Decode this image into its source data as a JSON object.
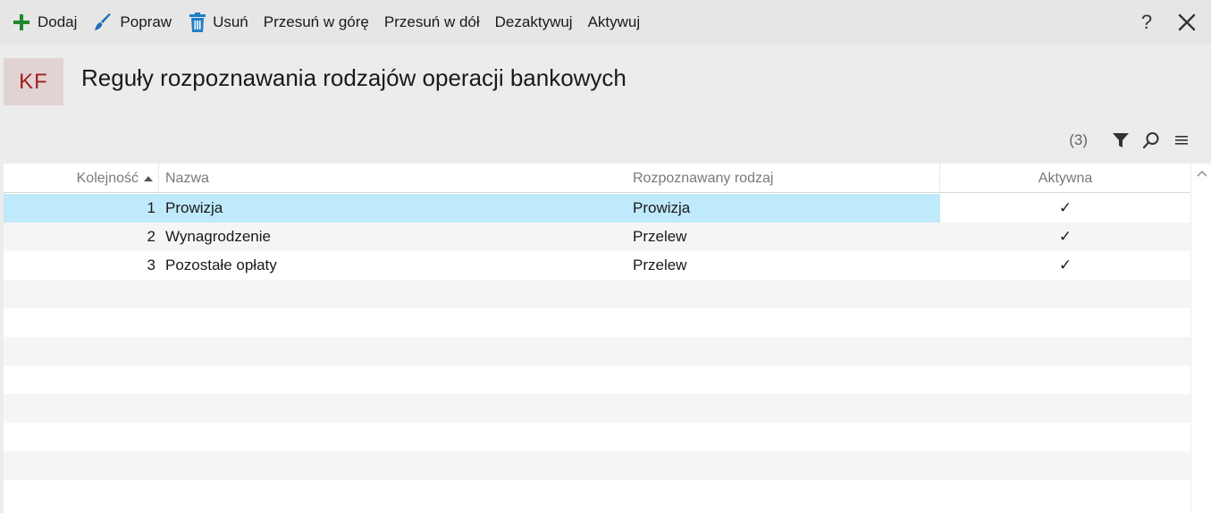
{
  "toolbar": {
    "add_label": "Dodaj",
    "edit_label": "Popraw",
    "delete_label": "Usuń",
    "move_up_label": "Przesuń w górę",
    "move_down_label": "Przesuń w dół",
    "deactivate_label": "Dezaktywuj",
    "activate_label": "Aktywuj",
    "help_label": "?"
  },
  "header": {
    "module_code": "KF",
    "title": "Reguły rozpoznawania rodzajów operacji bankowych",
    "record_count": "(3)"
  },
  "grid": {
    "columns": {
      "order": "Kolejność",
      "name": "Nazwa",
      "kind": "Rozpoznawany rodzaj",
      "active": "Aktywna"
    },
    "rows": [
      {
        "order": "1",
        "name": "Prowizja",
        "kind": "Prowizja",
        "active": "✓"
      },
      {
        "order": "2",
        "name": "Wynagrodzenie",
        "kind": "Przelew",
        "active": "✓"
      },
      {
        "order": "3",
        "name": "Pozostałe opłaty",
        "kind": "Przelew",
        "active": "✓"
      }
    ]
  },
  "colors": {
    "add_icon": "#1e8a2e",
    "brush_icon": "#1e6fb5",
    "trash_icon": "#1e7fc6",
    "module_badge_bg": "#e2d3d3",
    "module_badge_text": "#a11f1f",
    "selected_row": "#bfeafb"
  },
  "icons": [
    "plus-icon",
    "brush-icon",
    "trash-icon",
    "help-icon",
    "close-icon",
    "filter-icon",
    "search-icon",
    "menu-icon",
    "sort-asc-icon",
    "chevron-up-icon"
  ]
}
